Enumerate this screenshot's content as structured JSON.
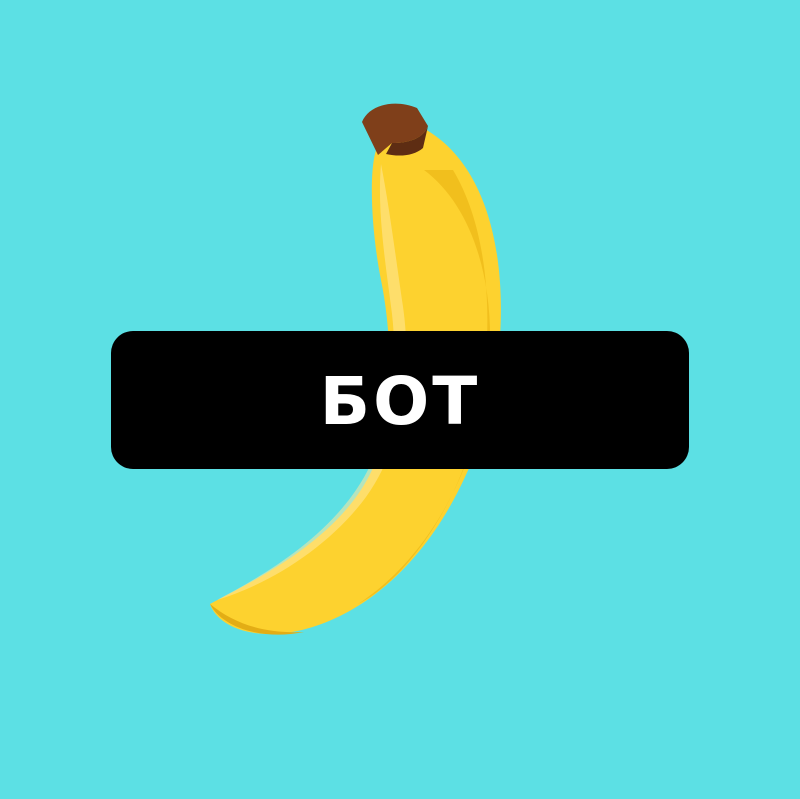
{
  "image": {
    "subject": "banana-icon",
    "background_color": "#5ce0e4"
  },
  "label": {
    "text": "БОТ",
    "background_color": "#000000",
    "text_color": "#ffffff"
  },
  "banana": {
    "body_color": "#fdd22f",
    "shade_color": "#f1bf1d",
    "highlight_color": "#ffe89c",
    "stem_color": "#7f3f1a"
  }
}
